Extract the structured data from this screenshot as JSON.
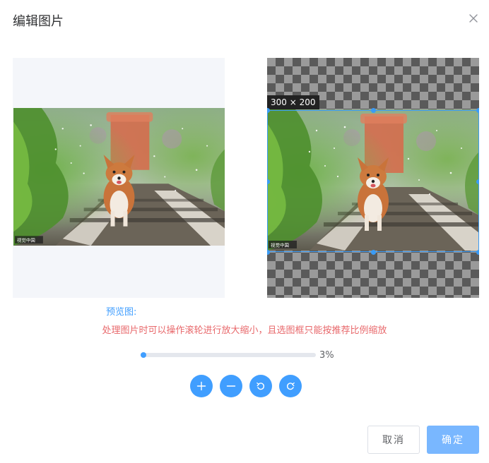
{
  "dialog": {
    "title": "编辑图片",
    "close_icon": "close-icon"
  },
  "cropper": {
    "crop_size_label": "300 × 200"
  },
  "photo": {
    "watermark": "视觉中国"
  },
  "preview": {
    "label": "预览图:",
    "hint": "处理图片时可以操作滚轮进行放大缩小，且选图框只能按推荐比例缩放"
  },
  "zoom": {
    "value_label": "3%",
    "value_fraction": 0.03
  },
  "tools": [
    {
      "name": "zoom-in-button",
      "icon": "plus-icon"
    },
    {
      "name": "zoom-out-button",
      "icon": "minus-icon"
    },
    {
      "name": "rotate-left-button",
      "icon": "rotate-left-icon"
    },
    {
      "name": "rotate-right-button",
      "icon": "rotate-right-icon"
    }
  ],
  "footer": {
    "cancel_label": "取消",
    "confirm_label": "确定"
  },
  "colors": {
    "accent": "#409eff",
    "hint": "#e8686b",
    "confirm_bg": "#79b7ff",
    "crop_border": "#3a9bf5"
  }
}
